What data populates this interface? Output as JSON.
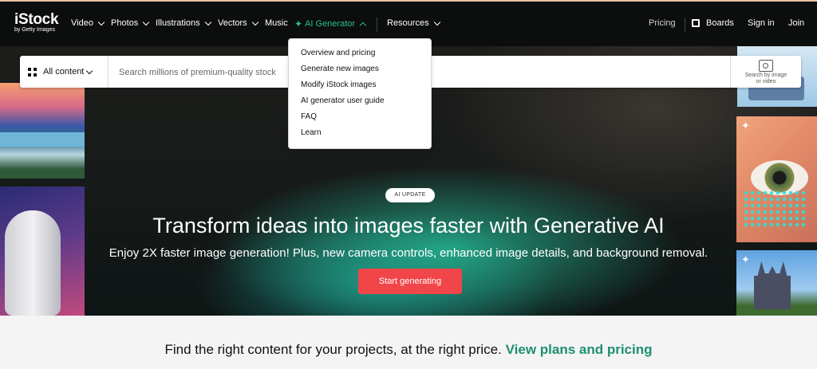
{
  "nav": {
    "logo": {
      "brand": "iStock",
      "sub": "by Getty Images"
    },
    "items": [
      {
        "label": "Video"
      },
      {
        "label": "Photos"
      },
      {
        "label": "Illustrations"
      },
      {
        "label": "Vectors"
      },
      {
        "label": "Music"
      },
      {
        "label": "AI Generator"
      },
      {
        "label": "Resources"
      }
    ],
    "right": {
      "pricing": "Pricing",
      "boards": "Boards",
      "sign_in": "Sign in",
      "join": "Join"
    }
  },
  "search": {
    "filter_label": "All content",
    "placeholder": "Search millions of premium-quality stock",
    "visual_search_label_1": "Search by image",
    "visual_search_label_2": "or video"
  },
  "ai_menu": {
    "items": [
      "Overview and pricing",
      "Generate new images",
      "Modify iStock images",
      "AI generator user guide",
      "FAQ",
      "Learn"
    ]
  },
  "hero": {
    "badge": "AI UPDATE",
    "headline": "Transform ideas into images faster with Generative AI",
    "subline": "Enjoy 2X faster image generation! Plus, new camera controls, enhanced image details, and background removal.",
    "cta": "Start generating"
  },
  "bottom": {
    "text": "Find the right content for your projects, at the right price.",
    "link": "View plans and pricing"
  },
  "colors": {
    "accent_green": "#28c08f",
    "cta_red": "#f0464a",
    "nav_bg": "#0c0d0d",
    "link_green": "#1d8f71"
  }
}
